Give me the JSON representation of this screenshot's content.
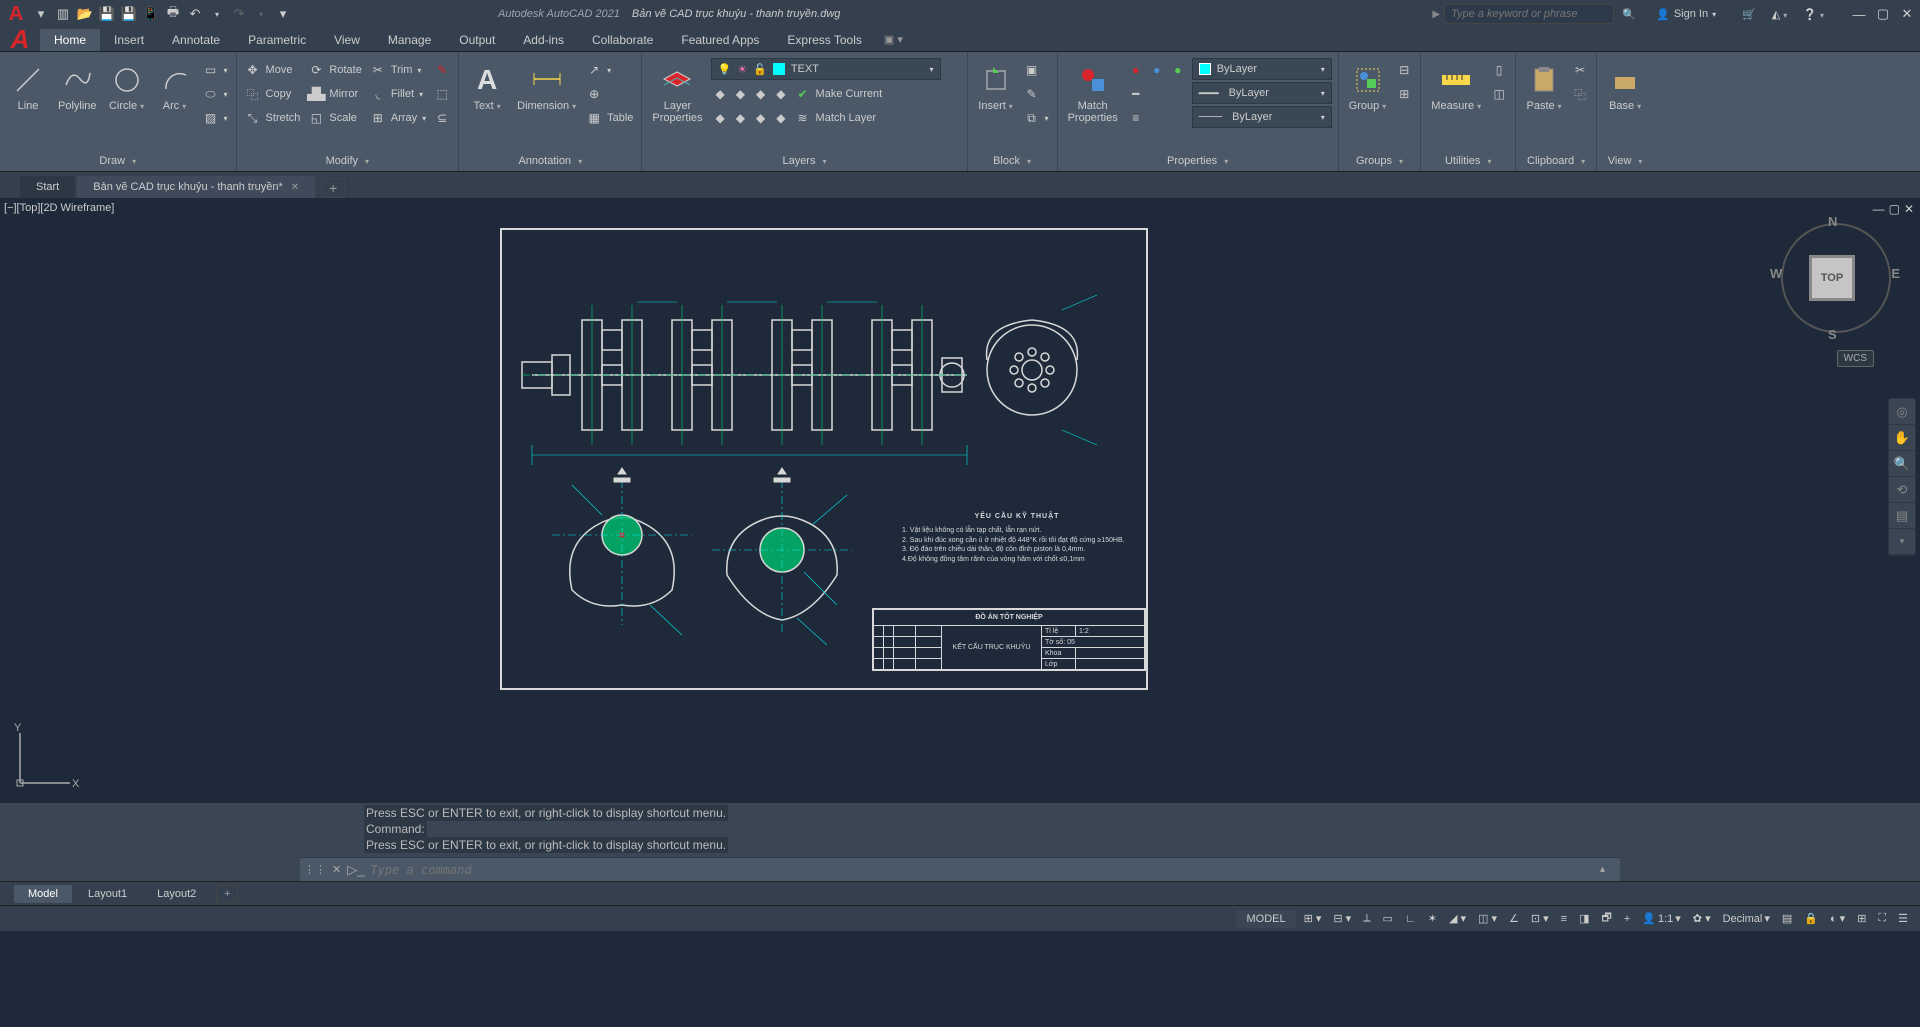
{
  "titlebar": {
    "app": "Autodesk AutoCAD 2021",
    "doc": "Bản vẽ CAD trục khuỷu - thanh truyền.dwg",
    "search_placeholder": "Type a keyword or phrase",
    "signin": "Sign In"
  },
  "menubar": {
    "tabs": [
      "Home",
      "Insert",
      "Annotate",
      "Parametric",
      "View",
      "Manage",
      "Output",
      "Add-ins",
      "Collaborate",
      "Featured Apps",
      "Express Tools"
    ]
  },
  "ribbon": {
    "draw": {
      "label": "Draw",
      "line": "Line",
      "polyline": "Polyline",
      "circle": "Circle",
      "arc": "Arc"
    },
    "modify": {
      "label": "Modify",
      "move": "Move",
      "rotate": "Rotate",
      "trim": "Trim",
      "copy": "Copy",
      "mirror": "Mirror",
      "fillet": "Fillet",
      "stretch": "Stretch",
      "scale": "Scale",
      "array": "Array"
    },
    "annotation": {
      "label": "Annotation",
      "text": "Text",
      "dimension": "Dimension",
      "table": "Table"
    },
    "layers": {
      "label": "Layers",
      "props": "Layer\nProperties",
      "current_layer": "TEXT",
      "make_current": "Make Current",
      "match_layer": "Match Layer"
    },
    "block": {
      "label": "Block",
      "insert": "Insert"
    },
    "properties": {
      "label": "Properties",
      "match": "Match\nProperties",
      "bylayer": "ByLayer"
    },
    "groups": {
      "label": "Groups",
      "group": "Group"
    },
    "utilities": {
      "label": "Utilities",
      "measure": "Measure"
    },
    "clipboard": {
      "label": "Clipboard",
      "paste": "Paste"
    },
    "view": {
      "label": "View",
      "base": "Base"
    }
  },
  "file_tabs": {
    "start": "Start",
    "doc": "Bản vẽ CAD trục khuỷu - thanh truyền*"
  },
  "viewport": {
    "label": "[−][Top][2D Wireframe]",
    "wcs": "WCS",
    "cube": "TOP",
    "n": "N",
    "e": "E",
    "s": "S",
    "w": "W"
  },
  "drawing_notes": {
    "title": "YÊU CẦU KỸ THUẬT",
    "n1": "1.  Vật liệu không có lẫn tạp chất, lẫn rạn nứt.",
    "n2": "2.  Sau khi đúc xong cần ủ ở nhiệt độ 448°K rồi tôi đạt độ cứng ≥150HB.",
    "n3": "3. Độ đảo trên chiều dài thân, độ côn đỉnh piston là 0,4mm.",
    "n4": "4.Độ không đồng tâm  rãnh của vòng hãm với chốt ≤0,1mm"
  },
  "title_block": {
    "main": "ĐỒ ÁN TỐT NGHIỆP",
    "sub": "KẾT CẤU TRỤC KHUỶU",
    "scale_l": "Tỉ lệ",
    "scale_v": "1:2",
    "sheet": "Tờ số: 05",
    "dept": "Khoa",
    "class": "Lớp"
  },
  "command": {
    "h1": "Press ESC or ENTER to exit, or right-click to display shortcut menu.",
    "h2": "Command:",
    "h3": "Press ESC or ENTER to exit, or right-click to display shortcut menu.",
    "placeholder": "Type a command"
  },
  "layout_tabs": [
    "Model",
    "Layout1",
    "Layout2"
  ],
  "statusbar": {
    "model": "MODEL",
    "scale": "1:1",
    "units": "Decimal"
  }
}
